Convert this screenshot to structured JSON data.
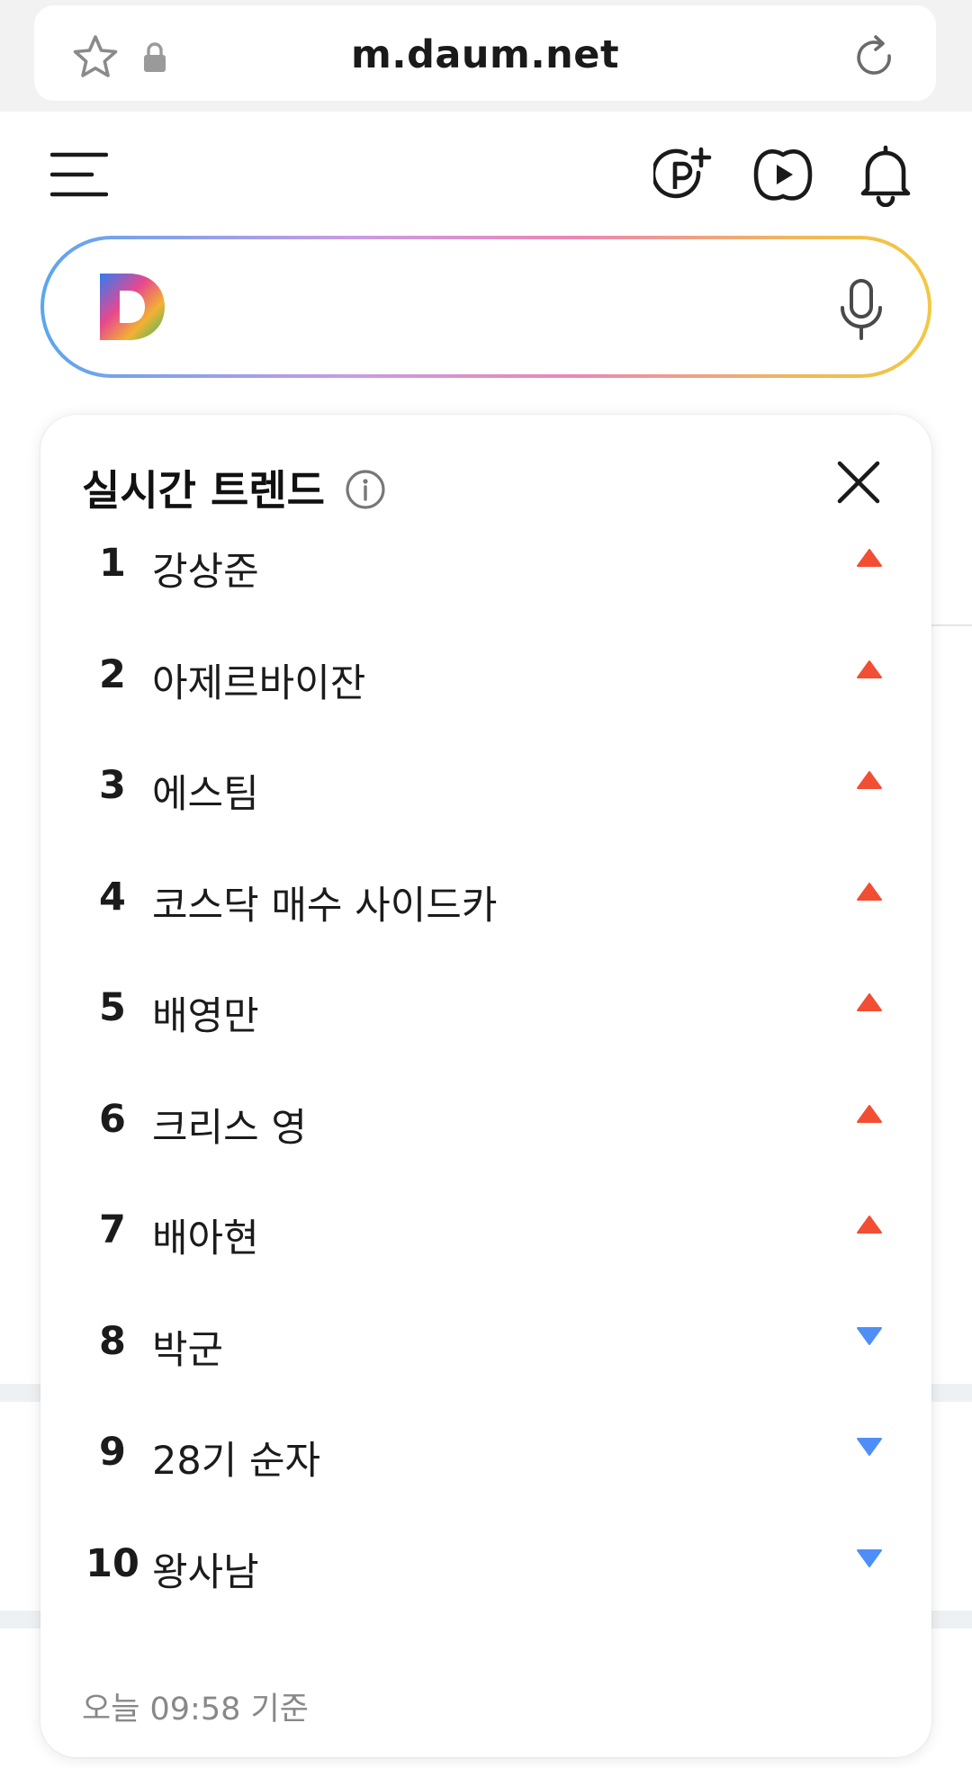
{
  "browser": {
    "url": "m.daum.net",
    "icons": [
      "star-icon",
      "lock-icon",
      "refresh-icon"
    ]
  },
  "header": {
    "icons": [
      "menu-icon",
      "pay-plus-icon",
      "tv-play-icon",
      "bell-icon"
    ]
  },
  "search": {
    "logo": "daum-d-logo",
    "icon": "mic-icon",
    "border_gradient": [
      "#5aa6ee",
      "#c99be6",
      "#ee86b4",
      "#f0b75c",
      "#f2c842"
    ]
  },
  "trends": {
    "title": "실시간 트렌드",
    "items": [
      {
        "rank": "1",
        "keyword": "강상준",
        "trend": "up"
      },
      {
        "rank": "2",
        "keyword": "아제르바이잔",
        "trend": "up"
      },
      {
        "rank": "3",
        "keyword": "에스팀",
        "trend": "up"
      },
      {
        "rank": "4",
        "keyword": "코스닥 매수 사이드카",
        "trend": "up"
      },
      {
        "rank": "5",
        "keyword": "배영만",
        "trend": "up"
      },
      {
        "rank": "6",
        "keyword": "크리스 영",
        "trend": "up"
      },
      {
        "rank": "7",
        "keyword": "배아현",
        "trend": "up"
      },
      {
        "rank": "8",
        "keyword": "박군",
        "trend": "down"
      },
      {
        "rank": "9",
        "keyword": "28기 순자",
        "trend": "down"
      },
      {
        "rank": "10",
        "keyword": "왕사남",
        "trend": "down"
      }
    ],
    "timestamp": "오늘 09:58 기준",
    "colors": {
      "up": "#f24e33",
      "down": "#4f8ef7"
    }
  }
}
